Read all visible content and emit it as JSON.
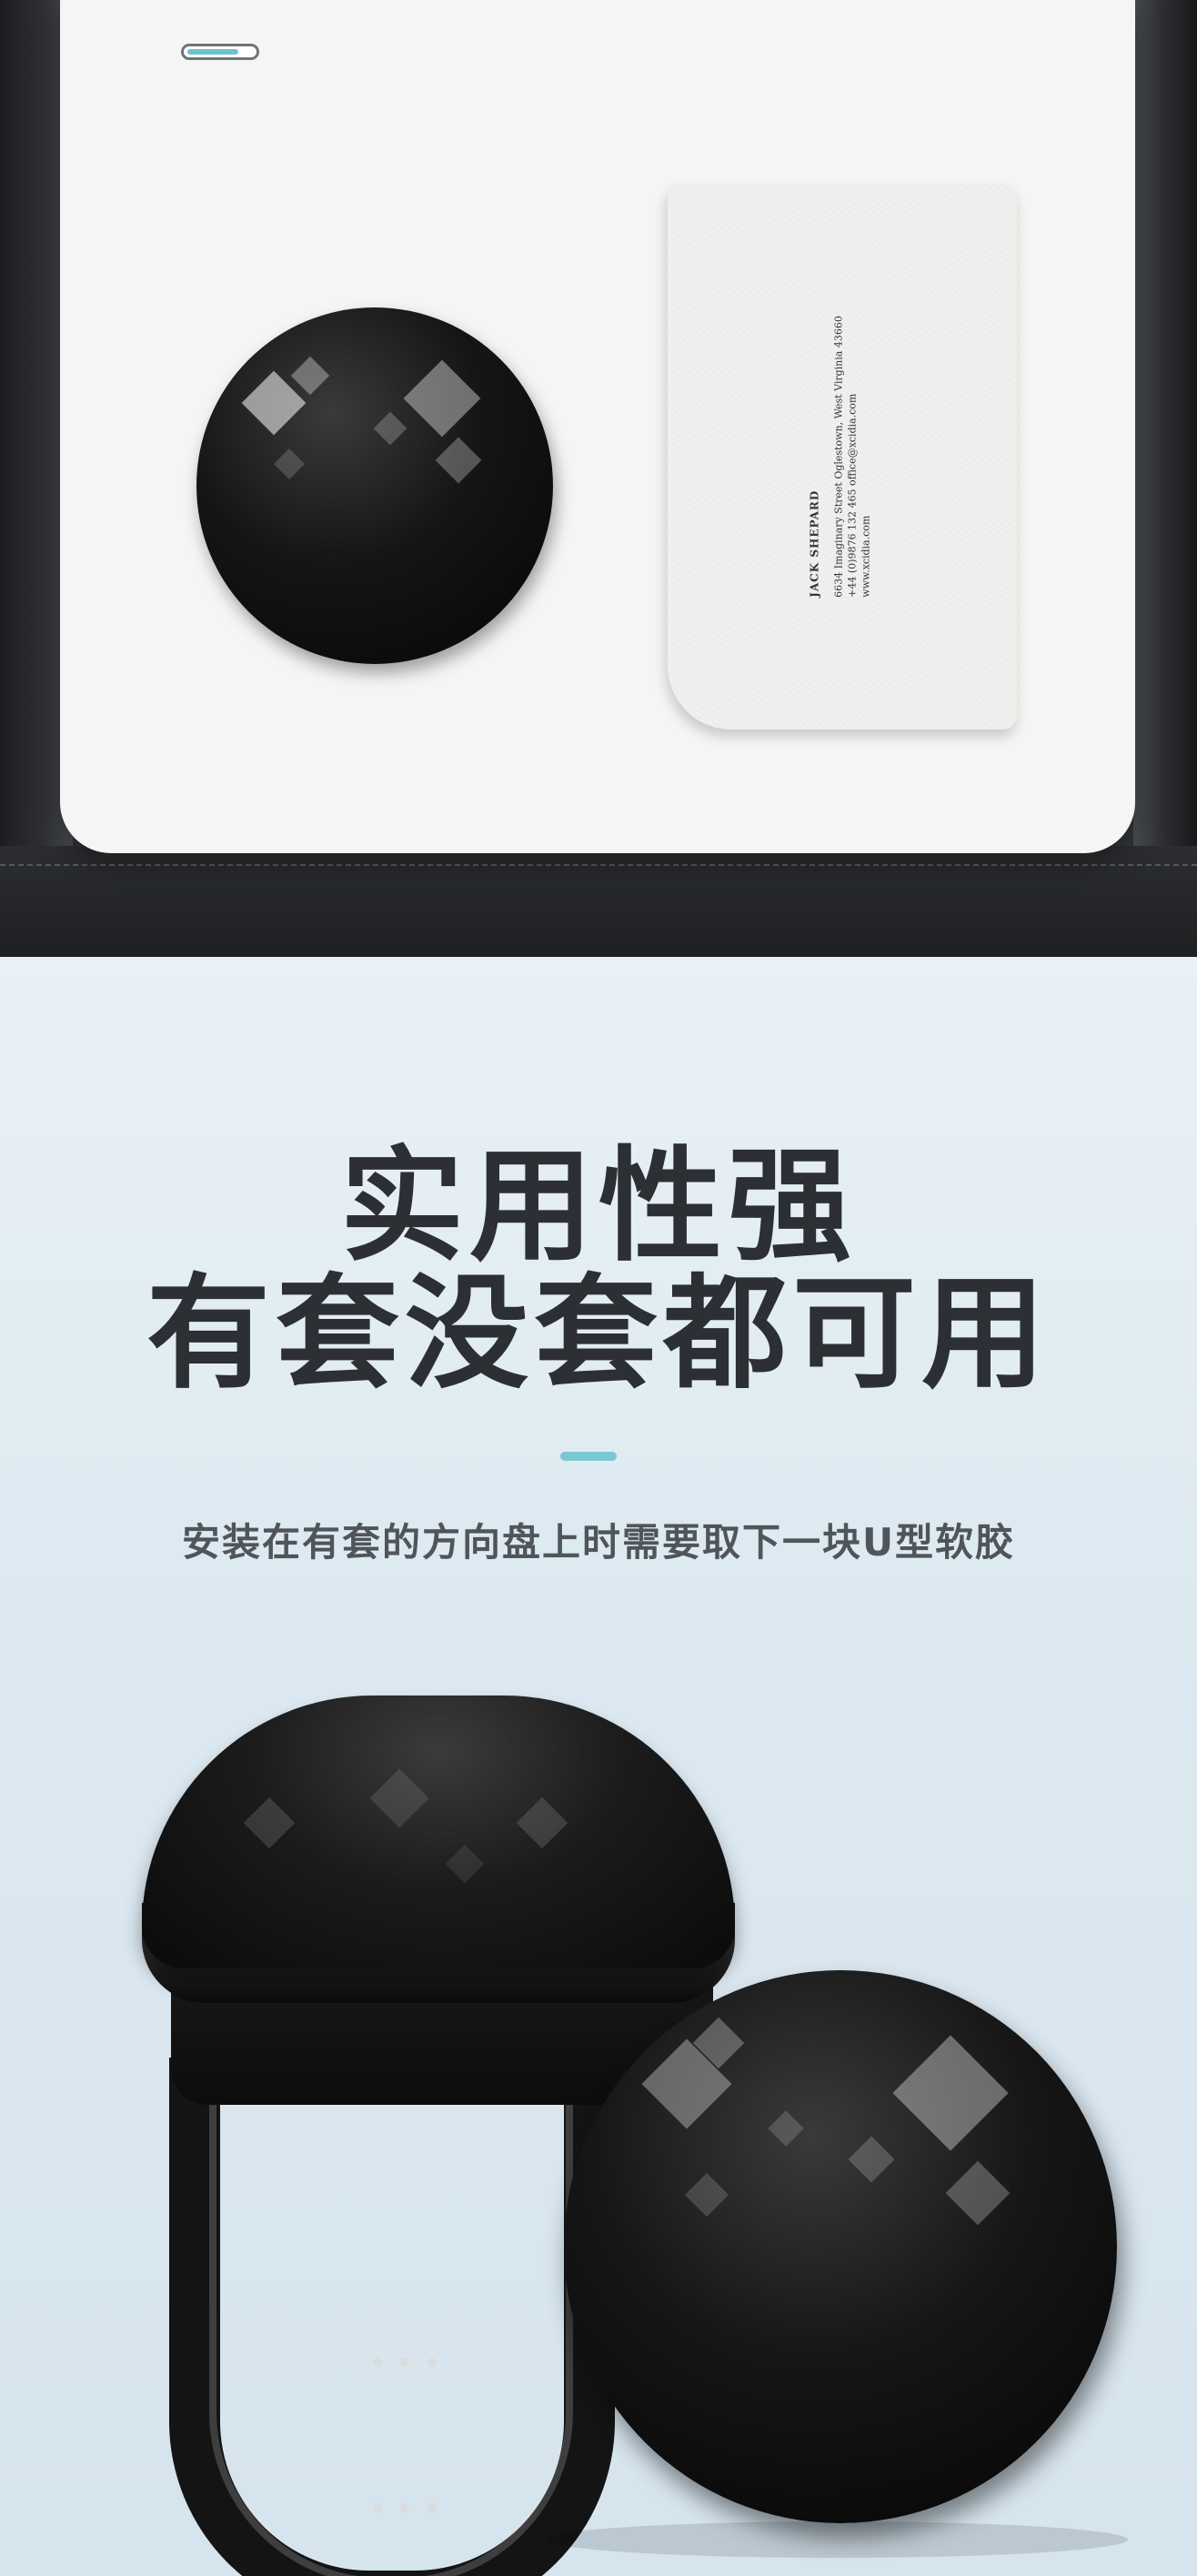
{
  "top": {
    "business_card": {
      "name": "JACK SHEPARD",
      "address": "6634 Imaginary Street Oglestown, West Virginia 43660",
      "contact": "+44 (0)9876 132 465  office@xcidia.com",
      "website": "www.xcidia.com"
    }
  },
  "bottom": {
    "headline_line1": "实用性强",
    "headline_line2": "有套没套都可用",
    "subtitle": "安装在有套的方向盘上时需要取下一块U型软胶",
    "accent_color": "#7ac8d2"
  }
}
